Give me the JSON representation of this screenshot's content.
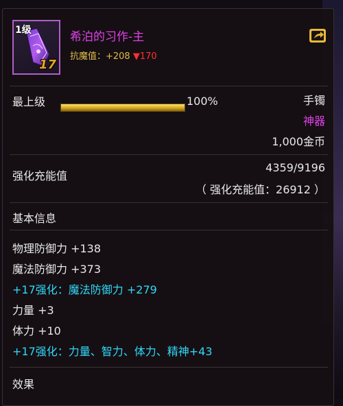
{
  "item": {
    "level_badge": "1级",
    "enhance_badge": "17",
    "name": "希泊的习作-主",
    "resist_label": "抗魔值：+208",
    "resist_down": "▼170"
  },
  "header": {
    "grade_label": "最上级",
    "grade_percent": "100%",
    "grade_fill": 1.0,
    "slot": "手镯",
    "rarity": "神器",
    "price": "1,000金币"
  },
  "charge": {
    "label": "强化充能值",
    "value": "4359/9196",
    "detail": "（ 强化充能值：26912 ）"
  },
  "basic": {
    "title": "基本信息",
    "stats": [
      {
        "text": "物理防御力 +138",
        "color": "white"
      },
      {
        "text": "魔法防御力 +373",
        "color": "white"
      },
      {
        "text": "+17强化：魔法防御力 +279",
        "color": "cyan"
      },
      {
        "text": "力量 +3",
        "color": "white"
      },
      {
        "text": "体力 +10",
        "color": "white"
      },
      {
        "text": "+17强化：力量、智力、体力、精神+43",
        "color": "cyan"
      }
    ]
  },
  "effects": {
    "title": "效果"
  },
  "colors": {
    "name": "#e040e8",
    "rarity": "#e040e8",
    "enhance": "#30d8f8",
    "resist": "#e0bc4a",
    "down": "#ff3030",
    "bar": "#d3a71e"
  },
  "icons": {
    "share": "share-external-icon",
    "item": "bracelet-item-icon"
  }
}
